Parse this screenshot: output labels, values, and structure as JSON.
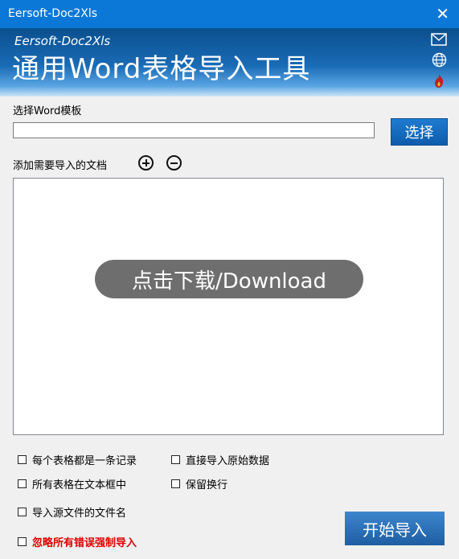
{
  "window": {
    "title": "Eersoft-Doc2Xls",
    "close_glyph": "✕"
  },
  "banner": {
    "subtitle": "Eersoft-Doc2Xls",
    "title": "通用Word表格导入工具",
    "icons": [
      "mail-icon",
      "globe-icon",
      "flame-icon"
    ]
  },
  "template": {
    "label": "选择Word模板",
    "path_value": "",
    "select_button": "选择"
  },
  "documents": {
    "label": "添加需要导入的文档",
    "overlay_text": "点击下载/Download",
    "items": []
  },
  "options": [
    {
      "label": "每个表格都是一条记录",
      "checked": false
    },
    {
      "label": "直接导入原始数据",
      "checked": false
    },
    {
      "label": "所有表格在文本框中",
      "checked": false
    },
    {
      "label": "保留换行",
      "checked": false
    },
    {
      "label": "导入源文件的文件名",
      "checked": false
    },
    {
      "label": "忽略所有错误强制导入",
      "checked": false,
      "color": "#e00000"
    }
  ],
  "start_button": "开始导入",
  "colors": {
    "titlebar": "#0b78d7",
    "accent_blue": "#0d5bab",
    "warning_red": "#e00000"
  }
}
